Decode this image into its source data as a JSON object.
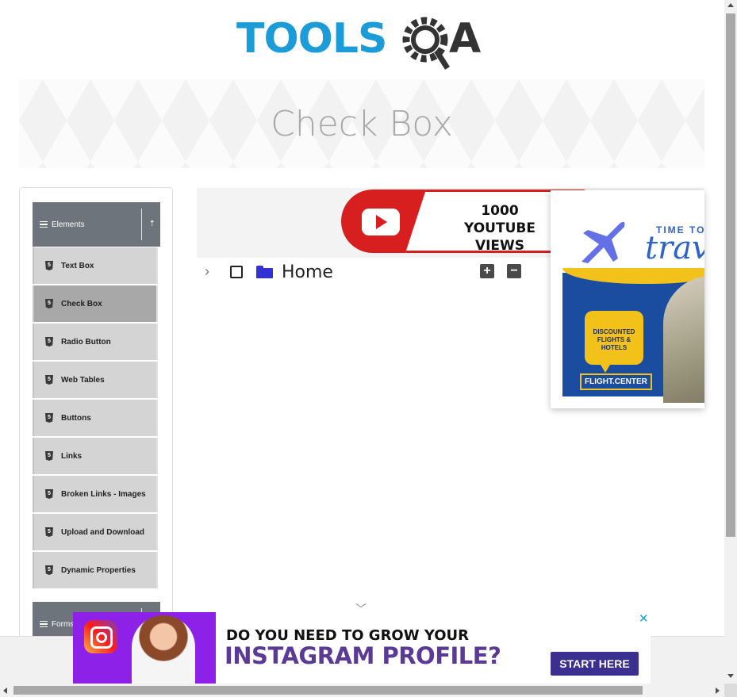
{
  "header": {
    "logo_text": "TOOLSQA"
  },
  "banner": {
    "title": "Check Box"
  },
  "sidebar": {
    "groups": [
      {
        "label": "Elements"
      },
      {
        "label": "Forms"
      }
    ],
    "items": [
      {
        "label": "Text Box"
      },
      {
        "label": "Check Box"
      },
      {
        "label": "Radio Button"
      },
      {
        "label": "Web Tables"
      },
      {
        "label": "Buttons"
      },
      {
        "label": "Links"
      },
      {
        "label": "Broken Links - Images"
      },
      {
        "label": "Upload and Download"
      },
      {
        "label": "Dynamic Properties"
      }
    ],
    "active_item": "Check Box"
  },
  "tree": {
    "root_label": "Home",
    "expand_all_symbol": "+",
    "collapse_all_symbol": "−",
    "checked": false
  },
  "ads": {
    "youtube": {
      "line1": "1000",
      "line2": "YOUTUBE VIEWS"
    },
    "travel": {
      "time_to": "TIME TO",
      "travel": "travel",
      "offer_line1": "DISCOUNTED",
      "offer_line2": "FLIGHTS & HOTELS",
      "brand": "FLIGHT.CENTER"
    },
    "instagram": {
      "line1": "DO YOU NEED TO GROW YOUR",
      "line2": "INSTAGRAM PROFILE?",
      "cta": "START HERE",
      "close": "✕"
    }
  },
  "colors": {
    "sidebar_header": "#6e747b",
    "menu_item": "#d4d4d4",
    "menu_item_active": "#a8a8a8",
    "folder": "#3231d6",
    "logo_blue": "#1b9bd7"
  }
}
